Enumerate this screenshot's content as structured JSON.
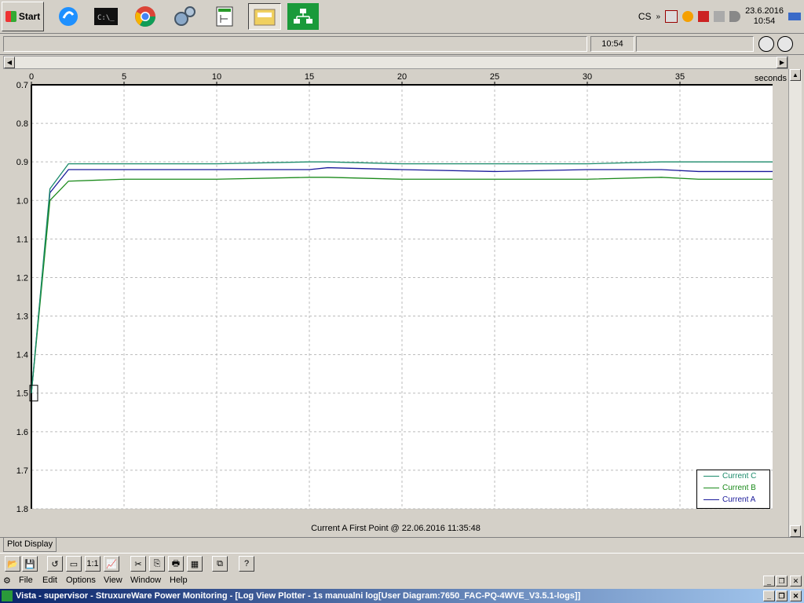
{
  "taskbar": {
    "start_label": "Start",
    "tray_text": "CS",
    "clock_date": "23.6.2016",
    "clock_time": "10:54",
    "apps": [
      "browser-app-icon",
      "console-app-icon",
      "chrome-app-icon",
      "settings-app-icon",
      "chart-editor-app-icon",
      "folder-app-icon",
      "network-app-icon"
    ]
  },
  "statusbar": {
    "time": "10:54"
  },
  "plot": {
    "x_unit": "seconds",
    "footer": "Current A First Point @ 22.06.2016 11:35:48",
    "tab_label": "Plot Display"
  },
  "chart_data": {
    "type": "line",
    "ylabel": "",
    "xlabel": "seconds",
    "xlim": [
      0,
      40
    ],
    "ylim": [
      0.7,
      1.8
    ],
    "y_reversed": true,
    "x_ticks": [
      0,
      5,
      10,
      15,
      20,
      25,
      30,
      35
    ],
    "y_ticks": [
      0.7,
      0.8,
      0.9,
      1.0,
      1.1,
      1.2,
      1.3,
      1.4,
      1.5,
      1.6,
      1.7,
      1.8
    ],
    "y_tick_labels": [
      "0.7",
      "0.8",
      "0.9",
      "1.0",
      "1.1",
      "1.2",
      "1.3",
      "1.4",
      "1.5",
      "1.6",
      "1.7",
      "1.8"
    ],
    "grid": true,
    "legend_position": "bottom-right",
    "x": [
      0,
      1,
      2,
      5,
      10,
      15,
      16,
      20,
      25,
      30,
      34,
      36,
      40
    ],
    "series": [
      {
        "name": "Current A",
        "color": "#1a1a9a",
        "values": [
          1.5,
          0.98,
          0.92,
          0.92,
          0.92,
          0.92,
          0.915,
          0.92,
          0.925,
          0.92,
          0.92,
          0.925,
          0.925
        ]
      },
      {
        "name": "Current B",
        "color": "#1a8a1a",
        "values": [
          1.5,
          1.0,
          0.95,
          0.945,
          0.945,
          0.94,
          0.94,
          0.945,
          0.945,
          0.945,
          0.94,
          0.945,
          0.945
        ]
      },
      {
        "name": "Current C",
        "color": "#1a8a6a",
        "values": [
          1.5,
          0.97,
          0.905,
          0.905,
          0.905,
          0.9,
          0.9,
          0.905,
          0.905,
          0.905,
          0.9,
          0.9,
          0.9
        ]
      }
    ]
  },
  "menu": [
    "File",
    "Edit",
    "Options",
    "View",
    "Window",
    "Help"
  ],
  "title": "Vista - supervisor - StruxureWare Power Monitoring - [Log View Plotter - 1s manualni log[User Diagram:7650_FAC-PQ-4WVE_V3.5.1-logs]]"
}
